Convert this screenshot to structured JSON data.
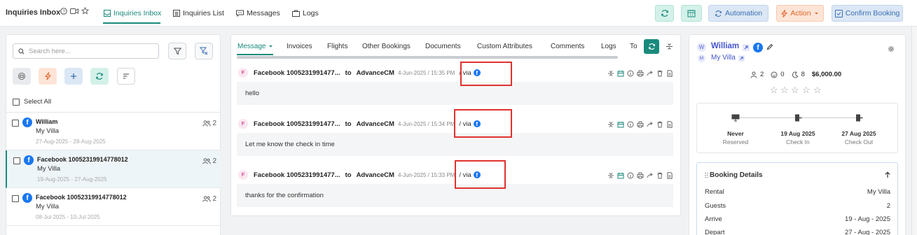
{
  "header": {
    "title": "Inquiries Inbox",
    "nav": [
      {
        "label": "Inquiries Inbox",
        "active": true
      },
      {
        "label": "Inquiries List"
      },
      {
        "label": "Messages"
      },
      {
        "label": "Logs"
      }
    ],
    "buttons": {
      "automation": "Automation",
      "action": "Action",
      "confirm_booking": "Confirm Booking"
    }
  },
  "sidebar": {
    "search_placeholder": "Search here...",
    "select_all": "Select All",
    "conversations": [
      {
        "name": "William",
        "property": "My Villa",
        "dates": "27-Aug-2025 - 28-Aug-2025",
        "guests": "2",
        "selected": false
      },
      {
        "name": "Facebook 10052319914778012",
        "property": "My Villa",
        "dates": "19-Aug-2025 - 27-Aug-2025",
        "guests": "2",
        "selected": true
      },
      {
        "name": "Facebook 10052319914778012",
        "property": "My Villa",
        "dates": "08-Jul-2025 - 10-Jul-2025",
        "guests": "2",
        "selected": false
      }
    ]
  },
  "tabs": [
    "Message",
    "Invoices",
    "Flights",
    "Other Bookings",
    "Documents",
    "Custom Attributes",
    "Comments",
    "Logs",
    "To"
  ],
  "messages": [
    {
      "avatar": "F",
      "from": "Facebook 1005231991477...",
      "to": "to",
      "recipient": "AdvanceCM",
      "time": "4-Jun-2025 / 15:35 PM",
      "via": "/ via",
      "body": "hello"
    },
    {
      "avatar": "F",
      "from": "Facebook 1005231991477...",
      "to": "to",
      "recipient": "AdvanceCM",
      "time": "4-Jun-2025 / 15:34 PM",
      "via": "/ via",
      "body": "Let me know the check in time"
    },
    {
      "avatar": "F",
      "from": "Facebook 1005231991477...",
      "to": "to",
      "recipient": "AdvanceCM",
      "time": "4-Jun-2025 / 15:33 PM",
      "via": "/ via",
      "body": "thanks for the confirmation"
    }
  ],
  "guest": {
    "avatar": "W",
    "name": "William",
    "property_avatar": "M",
    "property": "My Villa",
    "adults": "2",
    "children": "0",
    "nights": "8",
    "total": "$6,000.00",
    "rating": 0,
    "timeline": [
      {
        "value": "Never",
        "label": "Reserved"
      },
      {
        "value": "19 Aug 2025",
        "label": "Check In"
      },
      {
        "value": "27 Aug 2025",
        "label": "Check Out"
      }
    ]
  },
  "booking_details": {
    "title": "Booking Details",
    "rows": [
      {
        "label": "Rental",
        "value": "My Villa"
      },
      {
        "label": "Guests",
        "value": "2"
      },
      {
        "label": "Arrive",
        "value": "19 - Aug - 2025"
      },
      {
        "label": "Depart",
        "value": "27 - Aug - 2025"
      }
    ]
  },
  "colors": {
    "accent": "#1a8a7c",
    "facebook": "#1877f2",
    "highlight": "#e0322f"
  }
}
